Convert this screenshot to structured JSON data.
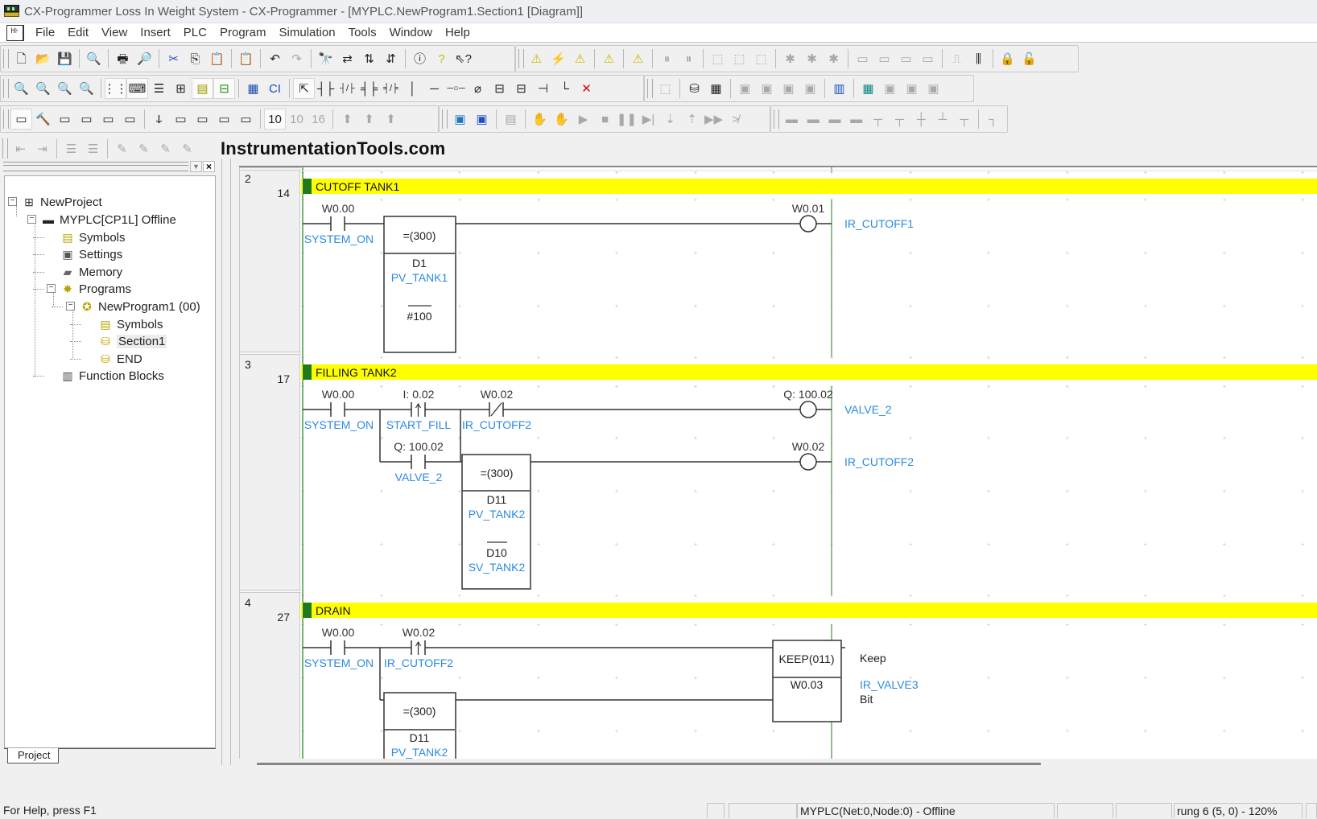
{
  "window": {
    "title": "CX-Programmer Loss In Weight System - CX-Programmer - [MYPLC.NewProgram1.Section1 [Diagram]]"
  },
  "menu": {
    "items": [
      "File",
      "Edit",
      "View",
      "Insert",
      "PLC",
      "Program",
      "Simulation",
      "Tools",
      "Window",
      "Help"
    ]
  },
  "toolbars": {
    "row1": [
      {
        "name": "new-icon",
        "glyph": "🗋"
      },
      {
        "name": "open-icon",
        "glyph": "📂"
      },
      {
        "name": "save-icon",
        "glyph": "💾"
      },
      {
        "sep": true
      },
      {
        "name": "print-preview-doc-icon",
        "glyph": "🔍"
      },
      {
        "sep": true
      },
      {
        "name": "print-icon",
        "glyph": "🖶"
      },
      {
        "name": "print-preview-icon",
        "glyph": "🔎"
      },
      {
        "sep": true
      },
      {
        "name": "cut-icon",
        "glyph": "✂"
      },
      {
        "name": "copy-icon",
        "glyph": "⎘"
      },
      {
        "name": "paste-icon",
        "glyph": "📋"
      },
      {
        "sep": true
      },
      {
        "name": "paste-special-icon",
        "glyph": "📋"
      },
      {
        "sep": true
      },
      {
        "name": "undo-icon",
        "glyph": "↶"
      },
      {
        "name": "redo-icon",
        "glyph": "↷",
        "disabled": true
      },
      {
        "sep": true
      },
      {
        "name": "find-icon",
        "glyph": "🔭"
      },
      {
        "name": "replace-icon",
        "glyph": "⇄"
      },
      {
        "name": "cross-reference-icon",
        "glyph": "⇅"
      },
      {
        "name": "address-reference-icon",
        "glyph": "⇵"
      },
      {
        "sep": true
      },
      {
        "name": "about-icon",
        "glyph": "ⓘ"
      },
      {
        "name": "help-icon",
        "glyph": "?"
      },
      {
        "name": "context-help-icon",
        "glyph": "⇖?"
      }
    ],
    "row1b": [
      {
        "name": "compile-warning-icon",
        "glyph": "⚠"
      },
      {
        "name": "compile-all-icon",
        "glyph": "⚡",
        "disabled": true
      },
      {
        "name": "find-errors-icon",
        "glyph": "⚠"
      },
      {
        "sep": true
      },
      {
        "name": "program-check-icon",
        "glyph": "⚠"
      },
      {
        "sep": true
      },
      {
        "name": "network-check-icon",
        "glyph": "⚠"
      },
      {
        "sep": true
      },
      {
        "name": "pause-monitor-icon",
        "glyph": "⏸",
        "disabled": true
      },
      {
        "name": "pause-icon",
        "glyph": "⏸",
        "disabled": true
      },
      {
        "sep": true
      },
      {
        "name": "transfer-to-pc-icon",
        "glyph": "⬚",
        "disabled": true
      },
      {
        "name": "transfer-to-plc-icon",
        "glyph": "⬚",
        "disabled": true
      },
      {
        "name": "compare-icon",
        "glyph": "⬚",
        "disabled": true
      },
      {
        "sep": true
      },
      {
        "name": "online-edit-icon",
        "glyph": "✱",
        "disabled": true
      },
      {
        "name": "online-edit-send-icon",
        "glyph": "✱",
        "disabled": true
      },
      {
        "name": "online-edit-cancel-icon",
        "glyph": "✱",
        "disabled": true
      },
      {
        "sep": true
      },
      {
        "name": "set-on-icon",
        "glyph": "▭",
        "disabled": true
      },
      {
        "name": "set-off-icon",
        "glyph": "▭",
        "disabled": true
      },
      {
        "name": "force-on-icon",
        "glyph": "▭",
        "disabled": true
      },
      {
        "name": "force-off-icon",
        "glyph": "▭",
        "disabled": true
      },
      {
        "sep": true
      },
      {
        "name": "differential-monitor-icon",
        "glyph": "⎍",
        "disabled": true
      },
      {
        "name": "data-trace-icon",
        "glyph": "⫼"
      },
      {
        "sep": true
      },
      {
        "name": "protect-icon",
        "glyph": "🔒"
      },
      {
        "name": "release-protect-icon",
        "glyph": "🔓",
        "disabled": true
      }
    ],
    "row2": [
      {
        "name": "zoom-small-icon",
        "glyph": "🔍"
      },
      {
        "name": "zoom-fit-icon",
        "glyph": "🔍"
      },
      {
        "name": "zoom-in-icon",
        "glyph": "🔍"
      },
      {
        "name": "zoom-out-icon",
        "glyph": "🔍",
        "disabled": true
      },
      {
        "sep": true
      },
      {
        "name": "grid-icon",
        "glyph": "⋮⋮",
        "pressed": true
      },
      {
        "name": "show-comments-icon",
        "glyph": "⌨",
        "pressed": true
      },
      {
        "name": "rung-annotations-icon",
        "glyph": "☰"
      },
      {
        "name": "show-attributes-icon",
        "glyph": "⊞"
      },
      {
        "name": "toggle-windows-icon",
        "glyph": "▤",
        "pressed": true
      },
      {
        "name": "project-workspace-icon",
        "glyph": "⊟",
        "pressed": true
      },
      {
        "sep": true
      },
      {
        "name": "symbol-table-icon",
        "glyph": "▦"
      },
      {
        "name": "cross-ref-window-icon",
        "glyph": "CI"
      },
      {
        "sep": true
      },
      {
        "name": "select-mode-icon",
        "glyph": "⇱",
        "pressed": true
      },
      {
        "name": "no-contact-icon",
        "glyph": "┤├"
      },
      {
        "name": "nc-contact-icon",
        "glyph": "┤/├"
      },
      {
        "name": "or-no-contact-icon",
        "glyph": "╡╞"
      },
      {
        "name": "or-nc-contact-icon",
        "glyph": "╡/╞"
      },
      {
        "name": "vertical-line-icon",
        "glyph": "│"
      },
      {
        "name": "horizontal-line-icon",
        "glyph": "─"
      },
      {
        "name": "no-coil-icon",
        "glyph": "─○─"
      },
      {
        "name": "nc-coil-icon",
        "glyph": "⌀"
      },
      {
        "name": "instruction-icon",
        "glyph": "⊟"
      },
      {
        "name": "function-block-icon",
        "glyph": "⊟"
      },
      {
        "name": "bit-contact-icon",
        "glyph": "⊣"
      },
      {
        "name": "line-connect-icon",
        "glyph": "└"
      },
      {
        "name": "delete-line-icon",
        "glyph": "✕"
      }
    ],
    "row2b": [
      {
        "name": "pt-memory-icon",
        "glyph": "⬚",
        "disabled": true
      },
      {
        "sep": true
      },
      {
        "name": "data-transfer-icon",
        "glyph": "⛁"
      },
      {
        "name": "data-table-icon",
        "glyph": "▦"
      },
      {
        "sep": true
      },
      {
        "name": "task-edit-icon",
        "glyph": "▣",
        "disabled": true
      },
      {
        "name": "task-delete-icon",
        "glyph": "▣",
        "disabled": true
      },
      {
        "name": "task-check-icon",
        "glyph": "▣",
        "disabled": true
      },
      {
        "name": "task-insert-icon",
        "glyph": "▣",
        "disabled": true
      },
      {
        "sep": true
      },
      {
        "name": "io-table-icon",
        "glyph": "▥"
      },
      {
        "sep": true
      },
      {
        "name": "memory-card-icon",
        "glyph": "▦"
      },
      {
        "name": "file-memory-icon",
        "glyph": "▣",
        "disabled": true
      },
      {
        "name": "file-delete-icon",
        "glyph": "▣",
        "disabled": true
      },
      {
        "name": "file-verify-icon",
        "glyph": "▣",
        "disabled": true
      }
    ],
    "row3": [
      {
        "name": "new-window-icon",
        "glyph": "▭",
        "pressed": true
      },
      {
        "name": "build-icon",
        "glyph": "🔨"
      },
      {
        "name": "chart-view-icon",
        "glyph": "▭"
      },
      {
        "name": "program-view-icon",
        "glyph": "▭"
      },
      {
        "name": "split-view-icon",
        "glyph": "▭"
      },
      {
        "name": "properties-icon",
        "glyph": "▭"
      },
      {
        "sep": true
      },
      {
        "name": "io-comment-icon",
        "glyph": "ↆ"
      },
      {
        "name": "symbols-view-icon",
        "glyph": "▭"
      },
      {
        "name": "ladder-view-icon",
        "glyph": "▭"
      },
      {
        "name": "mnemonic-view-icon",
        "glyph": "▭"
      },
      {
        "name": "watch-window-icon",
        "glyph": "▭"
      },
      {
        "sep": true
      },
      {
        "name": "decimal-display-icon",
        "glyph": "10",
        "pressed": true
      },
      {
        "name": "signed-decimal-icon",
        "glyph": "10",
        "disabled": true
      },
      {
        "name": "hex-display-icon",
        "glyph": "16",
        "disabled": true
      },
      {
        "sep": true
      },
      {
        "name": "online-1-icon",
        "glyph": "⬆",
        "disabled": true
      },
      {
        "name": "online-2-icon",
        "glyph": "⬆",
        "disabled": true
      },
      {
        "name": "online-3-icon",
        "glyph": "⬆",
        "disabled": true
      }
    ],
    "row3b": [
      {
        "name": "simulator-icon",
        "glyph": "▣"
      },
      {
        "name": "simulator-settings-icon",
        "glyph": "▣"
      },
      {
        "sep": true
      },
      {
        "name": "sim-transfer-icon",
        "glyph": "▤",
        "disabled": true
      },
      {
        "sep": true
      },
      {
        "name": "break-icon",
        "glyph": "✋",
        "disabled": true
      },
      {
        "name": "clear-break-icon",
        "glyph": "✋",
        "disabled": true
      },
      {
        "name": "run-icon",
        "glyph": "▶",
        "disabled": true
      },
      {
        "name": "stop-icon",
        "glyph": "■",
        "disabled": true
      },
      {
        "name": "pause-sim-icon",
        "glyph": "❚❚",
        "disabled": true
      },
      {
        "name": "step-run-icon",
        "glyph": "▶|",
        "disabled": true
      },
      {
        "name": "step-in-icon",
        "glyph": "⇣",
        "disabled": true
      },
      {
        "name": "step-out-icon",
        "glyph": "⇡",
        "disabled": true
      },
      {
        "name": "continuous-step-icon",
        "glyph": "▶▶",
        "disabled": true
      },
      {
        "name": "scan-run-icon",
        "glyph": "≯",
        "disabled": true
      }
    ],
    "row3c": [
      {
        "name": "block-icon-1",
        "glyph": "▬",
        "disabled": true
      },
      {
        "name": "block-icon-2",
        "glyph": "▬",
        "disabled": true
      },
      {
        "name": "block-icon-3",
        "glyph": "▬",
        "disabled": true
      },
      {
        "name": "block-icon-4",
        "glyph": "▬",
        "disabled": true
      },
      {
        "name": "branch-icon-1",
        "glyph": "┬",
        "disabled": true
      },
      {
        "name": "branch-icon-2",
        "glyph": "┬",
        "disabled": true
      },
      {
        "name": "branch-icon-3",
        "glyph": "┼",
        "disabled": true
      },
      {
        "name": "branch-icon-4",
        "glyph": "┴",
        "disabled": true
      },
      {
        "name": "branch-icon-5",
        "glyph": "┬",
        "disabled": true
      },
      {
        "sep": true
      },
      {
        "name": "step-line-icon",
        "glyph": "┐",
        "disabled": true
      }
    ],
    "row4": [
      {
        "name": "outdent-icon",
        "glyph": "⇤",
        "disabled": true
      },
      {
        "name": "indent-icon",
        "glyph": "⇥",
        "disabled": true
      },
      {
        "sep": true
      },
      {
        "name": "list-icon",
        "glyph": "☰",
        "disabled": true
      },
      {
        "name": "list-undo-icon",
        "glyph": "☰",
        "disabled": true
      },
      {
        "sep": true
      },
      {
        "name": "marker-icon-1",
        "glyph": "✎",
        "disabled": true
      },
      {
        "name": "marker-icon-2",
        "glyph": "✎",
        "disabled": true
      },
      {
        "name": "marker-icon-3",
        "glyph": "✎",
        "disabled": true
      },
      {
        "name": "marker-icon-4",
        "glyph": "✎",
        "disabled": true
      }
    ],
    "brand": "InstrumentationTools.com"
  },
  "project_tree": {
    "items": [
      {
        "label": "NewProject",
        "icon": "project-icon",
        "level": 0
      },
      {
        "label": "MYPLC[CP1L] Offline",
        "icon": "plc-icon",
        "level": 1
      },
      {
        "label": "Symbols",
        "icon": "symbols-icon",
        "level": 2
      },
      {
        "label": "Settings",
        "icon": "settings-icon",
        "level": 2
      },
      {
        "label": "Memory",
        "icon": "memory-icon",
        "level": 2
      },
      {
        "label": "Programs",
        "icon": "programs-icon",
        "level": 2
      },
      {
        "label": "NewProgram1 (00)",
        "icon": "program-icon",
        "level": 3
      },
      {
        "label": "Symbols",
        "icon": "symbols-icon",
        "level": 4
      },
      {
        "label": "Section1",
        "icon": "section-icon",
        "level": 4,
        "selected": true
      },
      {
        "label": "END",
        "icon": "section-icon",
        "level": 4
      },
      {
        "label": "Function Blocks",
        "icon": "function-blocks-icon",
        "level": 2
      }
    ],
    "tab": "Project"
  },
  "diagram": {
    "colors": {
      "comment_bar": "#ffff00",
      "comment_marker": "#1e7a1e",
      "symbol": "#2b8ae0",
      "rail": "#6aaa6a"
    },
    "rungs": [
      {
        "number": "2",
        "step": "14",
        "comment": "CUTOFF TANK1",
        "contact1": {
          "address": "W0.00",
          "symbol": "SYSTEM_ON"
        },
        "compare": {
          "instr": "=(300)",
          "op1": "D1",
          "op1_sym": "PV_TANK1",
          "op2": "#100"
        },
        "coil": {
          "address": "W0.01",
          "symbol": "IR_CUTOFF1"
        }
      },
      {
        "number": "3",
        "step": "17",
        "comment": "FILLING TANK2",
        "contact1": {
          "address": "W0.00",
          "symbol": "SYSTEM_ON"
        },
        "contact2": {
          "address": "I: 0.02",
          "symbol": "START_FILL"
        },
        "contact3": {
          "address": "W0.02",
          "symbol": "IR_CUTOFF2"
        },
        "contact_parallel": {
          "address": "Q: 100.02",
          "symbol": "VALVE_2"
        },
        "coil1": {
          "address": "Q: 100.02",
          "symbol": "VALVE_2"
        },
        "compare": {
          "instr": "=(300)",
          "op1": "D11",
          "op1_sym": "PV_TANK2",
          "op2": "D10",
          "op2_sym": "SV_TANK2"
        },
        "coil2": {
          "address": "W0.02",
          "symbol": "IR_CUTOFF2"
        }
      },
      {
        "number": "4",
        "step": "27",
        "comment": "DRAIN",
        "contact1": {
          "address": "W0.00",
          "symbol": "SYSTEM_ON"
        },
        "contact2": {
          "address": "W0.02",
          "symbol": "IR_CUTOFF2"
        },
        "keep": {
          "instr": "KEEP(011)",
          "operand": "W0.03",
          "label1": "Keep",
          "symbol": "IR_VALVE3",
          "label2": "Bit"
        },
        "compare": {
          "instr": "=(300)",
          "op1": "D11",
          "op1_sym": "PV_TANK2"
        }
      }
    ]
  },
  "statusbar": {
    "help": "For Help, press F1",
    "connection": "MYPLC(Net:0,Node:0) - Offline",
    "position": "rung 6 (5, 0)  - 120%"
  }
}
